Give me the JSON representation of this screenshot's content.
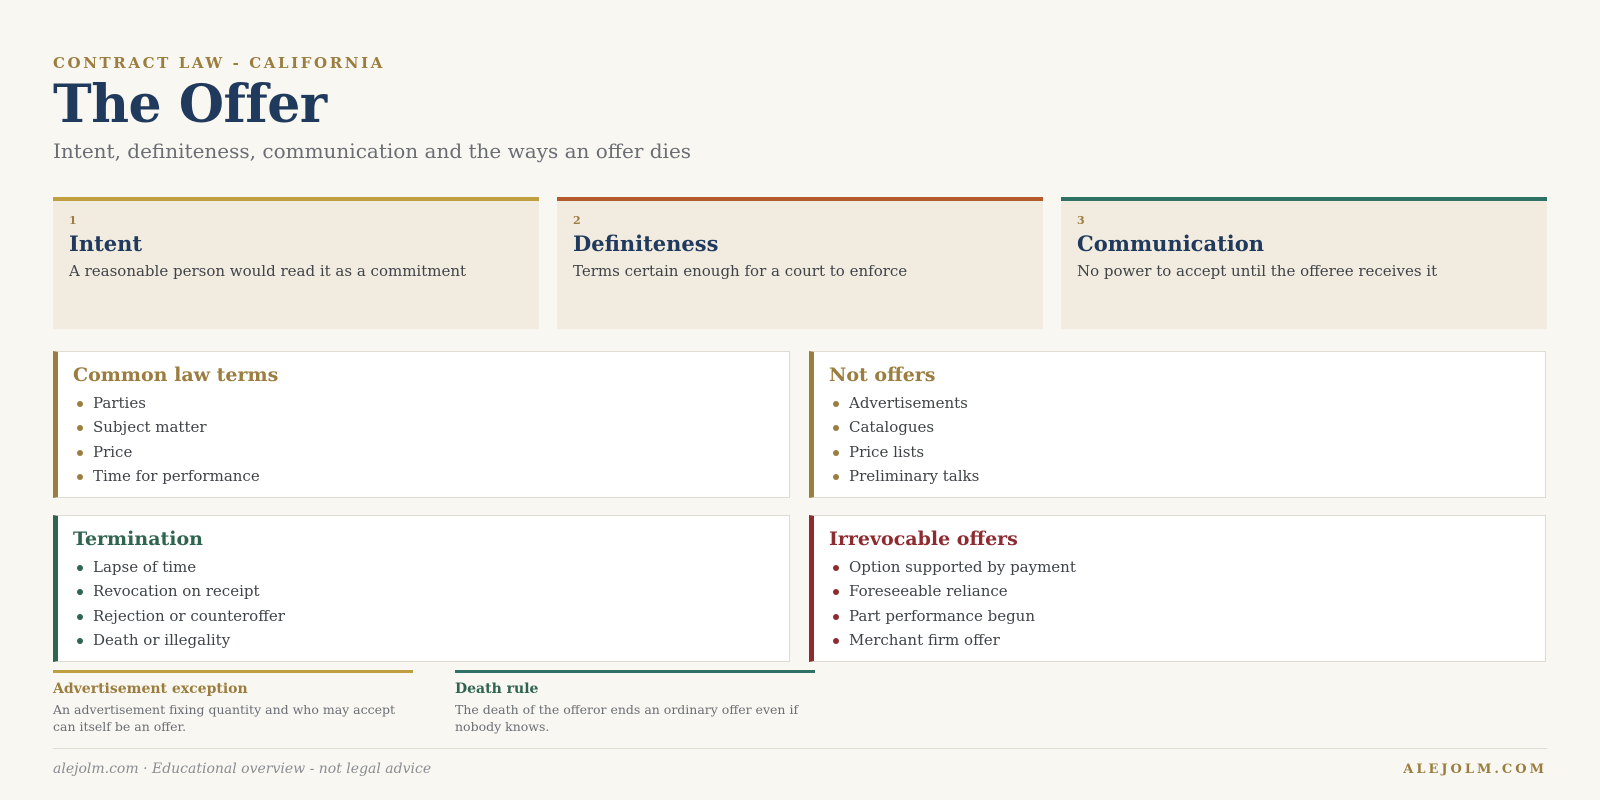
{
  "header": {
    "eyebrow": "CONTRACT LAW - CALIFORNIA",
    "title": "The Offer",
    "subtitle": "Intent, definiteness, communication and the ways an offer dies"
  },
  "pillars": [
    {
      "number": "1",
      "title": "Intent",
      "description": "A reasonable person would read it as a commitment",
      "accent": "#bf9f3f"
    },
    {
      "number": "2",
      "title": "Definiteness",
      "description": "Terms certain enough for a court to enforce",
      "accent": "#b55a2a"
    },
    {
      "number": "3",
      "title": "Communication",
      "description": "No power to accept until the offeree receives it",
      "accent": "#2e7266"
    }
  ],
  "panels": [
    {
      "title": "Common law terms",
      "accent": "#9a7d3f",
      "items": [
        "Parties",
        "Subject matter",
        "Price",
        "Time for performance"
      ]
    },
    {
      "title": "Not offers",
      "accent": "#9a7d3f",
      "items": [
        "Advertisements",
        "Catalogues",
        "Price lists",
        "Preliminary talks"
      ]
    },
    {
      "title": "Termination",
      "accent": "#2f6450",
      "items": [
        "Lapse of time",
        "Revocation on receipt",
        "Rejection or counteroffer",
        "Death or illegality"
      ]
    },
    {
      "title": "Irrevocable offers",
      "accent": "#8e2b30",
      "items": [
        "Option supported by payment",
        "Foreseeable reliance",
        "Part performance begun",
        "Merchant firm offer"
      ]
    }
  ],
  "notes": [
    {
      "title": "Advertisement exception",
      "body": "An advertisement fixing quantity and who may accept can itself be an offer.",
      "accent": "#bf9f3f"
    },
    {
      "title": "Death rule",
      "body": "The death of the offeror ends an ordinary offer even if nobody knows.",
      "accent": "#2e7266"
    }
  ],
  "footer": {
    "left": "alejolm.com · Educational overview - not legal advice",
    "right": "ALEJOLM.COM"
  }
}
